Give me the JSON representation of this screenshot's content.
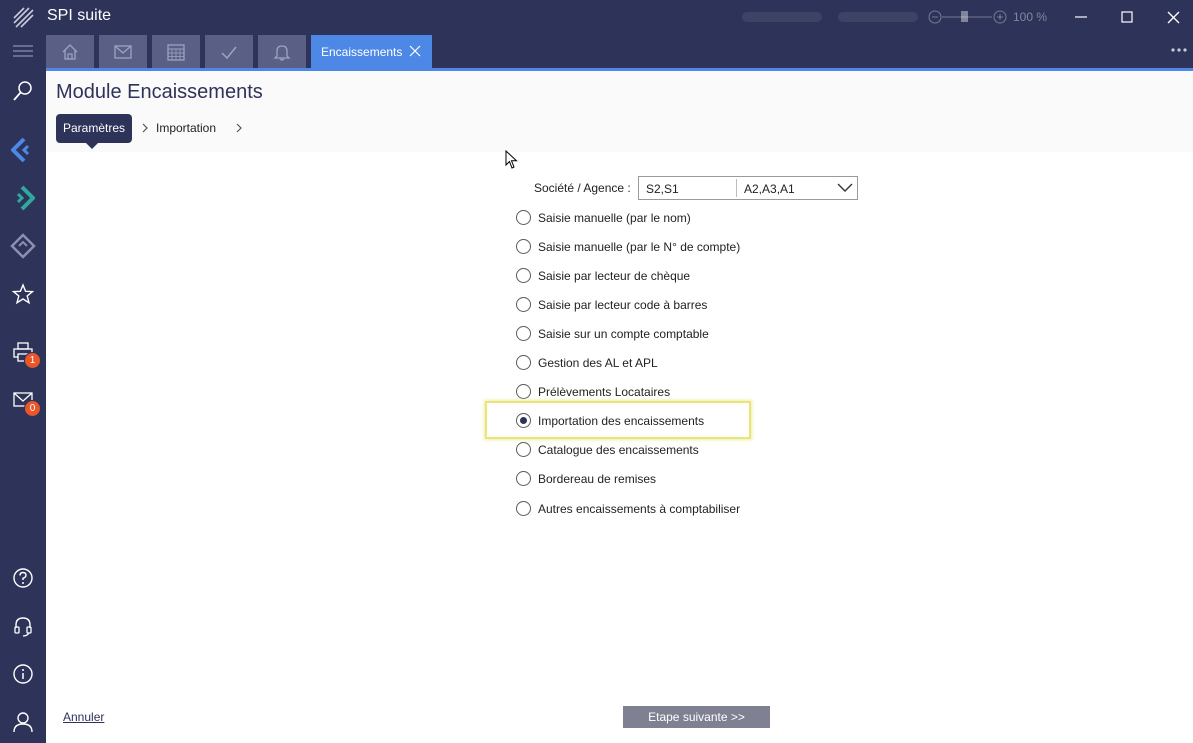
{
  "app": {
    "title": "SPI suite"
  },
  "titlebar": {
    "zoom_percent": "100 %"
  },
  "tabs": {
    "icon_tabs": [
      "home-icon",
      "mail-icon",
      "calendar-icon",
      "check-icon",
      "bell-icon"
    ],
    "active_label": "Encaissements"
  },
  "sidebar": {
    "badges": {
      "print": "1",
      "mail": "0"
    }
  },
  "page": {
    "title": "Module Encaissements",
    "breadcrumb": {
      "step1": "Paramètres",
      "step2": "Importation"
    }
  },
  "form": {
    "societe_label": "Société / Agence :",
    "societe_value": "S2,S1",
    "agence_value": "A2,A3,A1",
    "options": [
      {
        "label": "Saisie manuelle (par le nom)",
        "checked": false
      },
      {
        "label": "Saisie manuelle (par le N° de compte)",
        "checked": false
      },
      {
        "label": "Saisie par lecteur de chèque",
        "checked": false
      },
      {
        "label": "Saisie par lecteur code à barres",
        "checked": false
      },
      {
        "label": "Saisie sur un compte comptable",
        "checked": false
      },
      {
        "label": "Gestion des AL et APL",
        "checked": false
      },
      {
        "label": "Prélèvements Locataires",
        "checked": false
      },
      {
        "label": "Importation des encaissements",
        "checked": true
      },
      {
        "label": "Catalogue des encaissements",
        "checked": false
      },
      {
        "label": "Bordereau de remises",
        "checked": false
      },
      {
        "label": "Autres encaissements à comptabiliser",
        "checked": false
      }
    ]
  },
  "footer": {
    "cancel_label": "Annuler",
    "next_label": "Etape suivante >>"
  },
  "colors": {
    "nav_dark": "#2e3359",
    "accent_blue": "#4d88e6",
    "badge_orange": "#e8562a",
    "highlight": "#e8e67a"
  }
}
